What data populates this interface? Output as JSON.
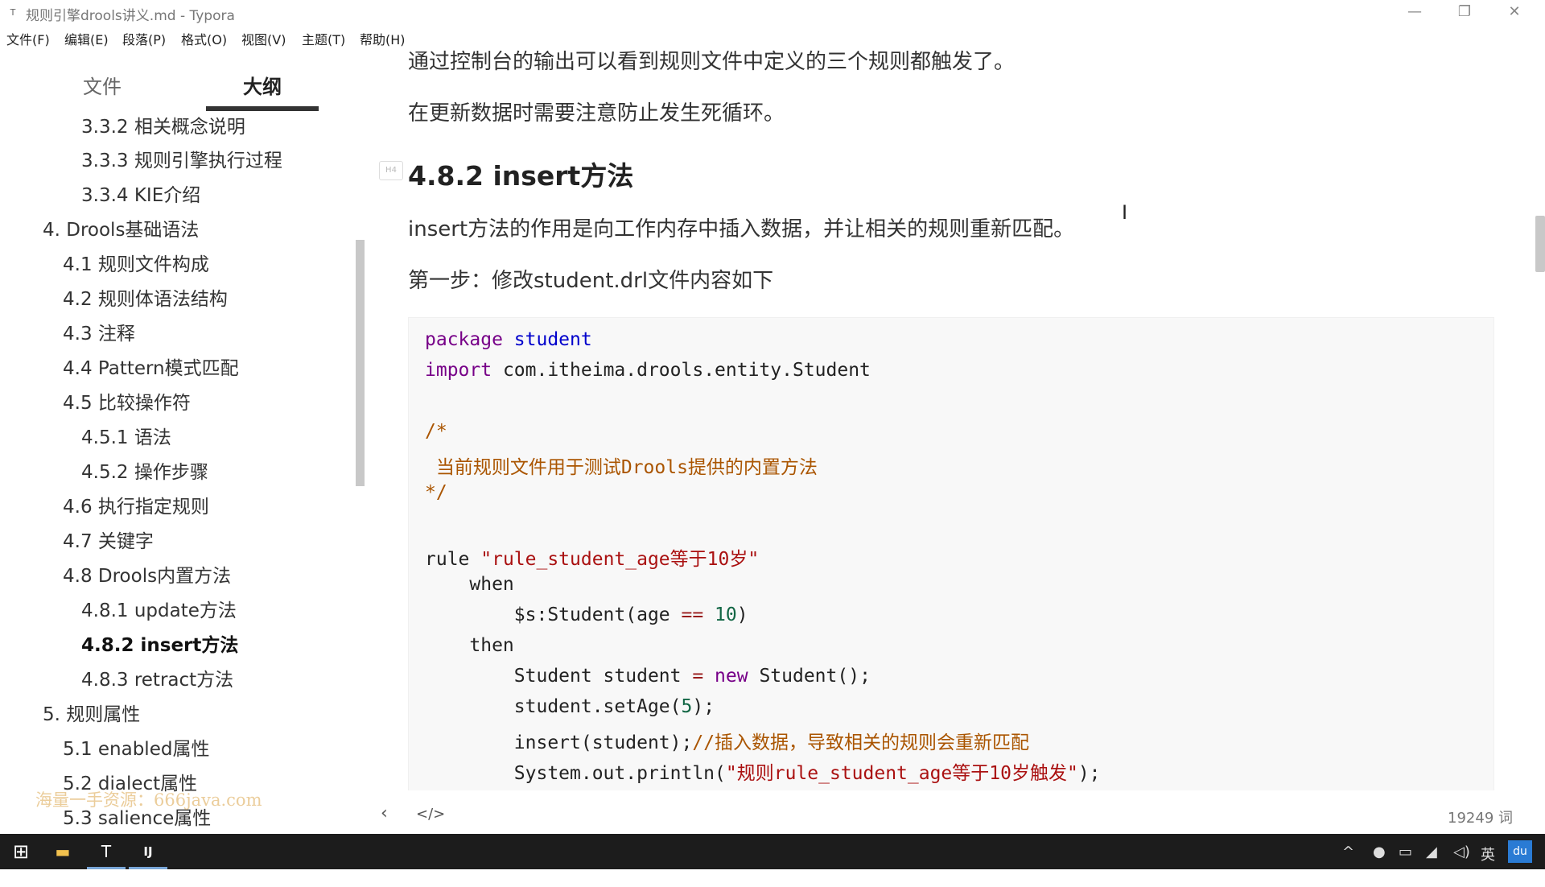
{
  "window": {
    "title": "规则引擎drools讲义.md - Typora",
    "app_icon": "T",
    "minimize": "—",
    "maximize": "❐",
    "close": "✕"
  },
  "menu": [
    "文件(F)",
    "编辑(E)",
    "段落(P)",
    "格式(O)",
    "视图(V)",
    "主题(T)",
    "帮助(H)"
  ],
  "sidebar": {
    "tabs": [
      "文件",
      "大纲"
    ],
    "active_tab": "大纲",
    "outline": [
      "3.3.2 相关概念说明",
      "3.3.3 规则引擎执行过程",
      "3.3.4 KIE介绍",
      "4. Drools基础语法",
      "4.1 规则文件构成",
      "4.2 规则体语法结构",
      "4.3 注释",
      "4.4 Pattern模式匹配",
      "4.5 比较操作符",
      "4.5.1 语法",
      "4.5.2 操作步骤",
      "4.6 执行指定规则",
      "4.7 关键字",
      "4.8 Drools内置方法",
      "4.8.1 update方法",
      "4.8.2 insert方法",
      "4.8.3 retract方法",
      "5. 规则属性",
      "5.1 enabled属性",
      "5.2 dialect属性",
      "5.3 salience属性"
    ],
    "active_item": "4.8.2 insert方法",
    "watermark": "海量一手资源：666java.com"
  },
  "content": {
    "p1": "通过控制台的输出可以看到规则文件中定义的三个规则都触发了。",
    "p2": "在更新数据时需要注意防止发生死循环。",
    "heading": "4.8.2 insert方法",
    "heading_marker": "H4",
    "p3": "insert方法的作用是向工作内存中插入数据，并让相关的规则重新匹配。",
    "p4": "第一步：修改student.drl文件内容如下",
    "code": {
      "l1_kw": "package",
      "l1_name": "student",
      "l2_kw": "import",
      "l2_rest": " com.itheima.drools.entity.Student",
      "l3": "/*",
      "l4": " 当前规则文件用于测试Drools提供的内置方法",
      "l5": "*/",
      "l6_kw": "rule ",
      "l6_str": "\"rule_student_age等于10岁\"",
      "l7": "    when",
      "l8_a": "        $s:Student(age ",
      "l8_op": "==",
      "l8_num": " 10",
      "l8_b": ")",
      "l9": "    then",
      "l10_a": "        Student student ",
      "l10_op": "=",
      "l10_kw": " new",
      "l10_b": " Student();",
      "l11_a": "        student.setAge(",
      "l11_num": "5",
      "l11_b": ");",
      "l12_a": "        insert(student);",
      "l12_cm": "//插入数据，导致相关的规则会重新匹配",
      "l13_a": "        System.out.println(",
      "l13_str": "\"规则rule_student_age等于10岁触发\"",
      "l13_b": ");"
    }
  },
  "statusbar": {
    "back_icon": "‹",
    "source_icon": "</>",
    "word_count": "19249 词"
  },
  "taskbar": {
    "start": "⊞",
    "explorer": "▬",
    "typora": "T",
    "idea": "IJ",
    "tray_lang": "英",
    "tray_du": "du"
  }
}
